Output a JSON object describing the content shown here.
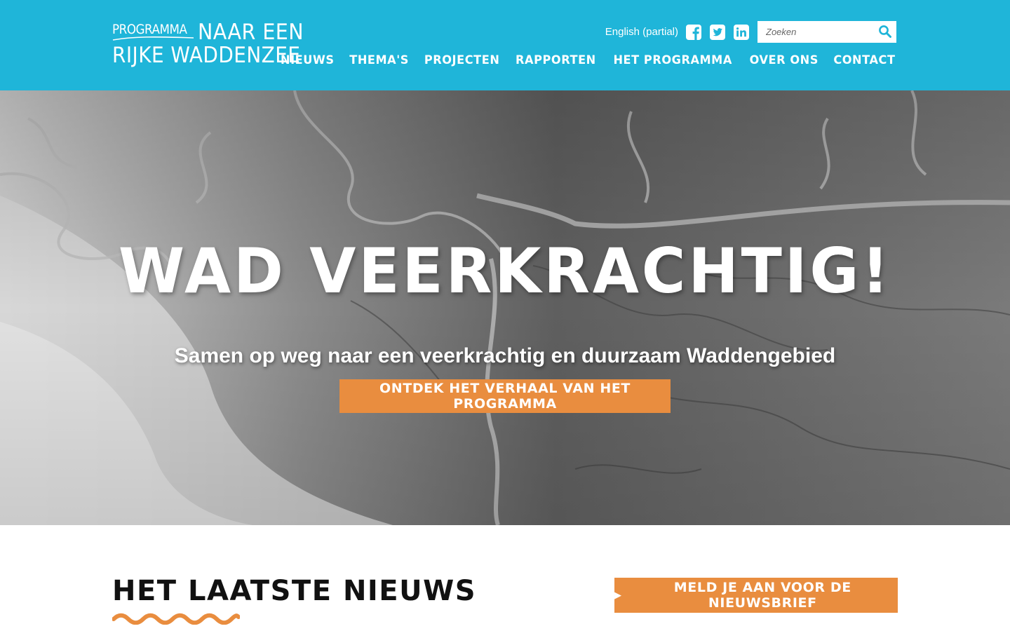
{
  "header": {
    "logo": {
      "line1_small": "PROGRAMMA",
      "line1_big": "NAAR EEN",
      "line2": "RIJKE WADDENZEE"
    },
    "language_link": "English (partial)",
    "social": [
      "facebook-icon",
      "twitter-icon",
      "linkedin-icon"
    ],
    "search": {
      "placeholder": "Zoeken",
      "value": ""
    },
    "nav": [
      "Nieuws",
      "Thema's",
      "Projecten",
      "Rapporten",
      "Het programma",
      "Over ons",
      "Contact"
    ]
  },
  "hero": {
    "title": "Wad veerkrachtig!",
    "subtitle": "Samen op weg naar een veerkrachtig en duurzaam Waddengebied",
    "button": "Ontdek het verhaal van het programma"
  },
  "news": {
    "title": "Het laatste nieuws",
    "newsletter_button": "Meld je aan voor de nieuwsbrief"
  },
  "colors": {
    "header_bg": "#1fb5d9",
    "accent_orange": "#e98d3f",
    "text_dark": "#111111",
    "white": "#ffffff"
  }
}
